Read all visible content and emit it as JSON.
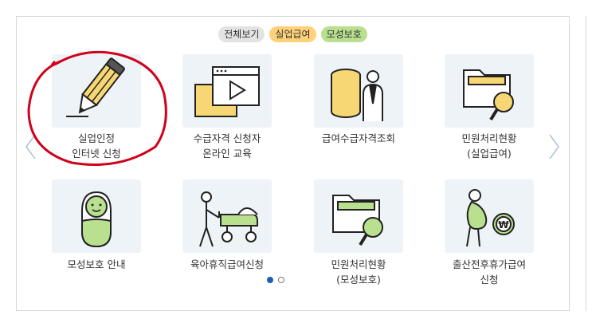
{
  "filters": [
    {
      "label": "전체보기",
      "color": "#e3e3e3"
    },
    {
      "label": "실업급여",
      "color": "#ffd27a"
    },
    {
      "label": "모성보호",
      "color": "#b8e08e"
    }
  ],
  "services": [
    {
      "label": "실업인정\n인터넷 신청",
      "icon": "pencil-icon"
    },
    {
      "label": "수급자격 신청자\n온라인 교육",
      "icon": "video-play-icon"
    },
    {
      "label": "급여수급자격조회",
      "icon": "database-person-icon"
    },
    {
      "label": "민원처리현황\n(실업급여)",
      "icon": "folder-search-icon"
    },
    {
      "label": "모성보호 안내",
      "icon": "baby-icon"
    },
    {
      "label": "육아휴직급여신청",
      "icon": "stroller-icon"
    },
    {
      "label": "민원처리현황\n(모성보호)",
      "icon": "folder-search-icon"
    },
    {
      "label": "출산전후휴가급여\n신청",
      "icon": "pregnant-coin-icon"
    }
  ],
  "pagination": {
    "current": 1,
    "total": 2
  },
  "colors": {
    "tile_bg": "#eef3f8",
    "accent_yellow": "#f7d774",
    "annotation_red": "#d0021b",
    "active_dot": "#1a5fb4"
  }
}
